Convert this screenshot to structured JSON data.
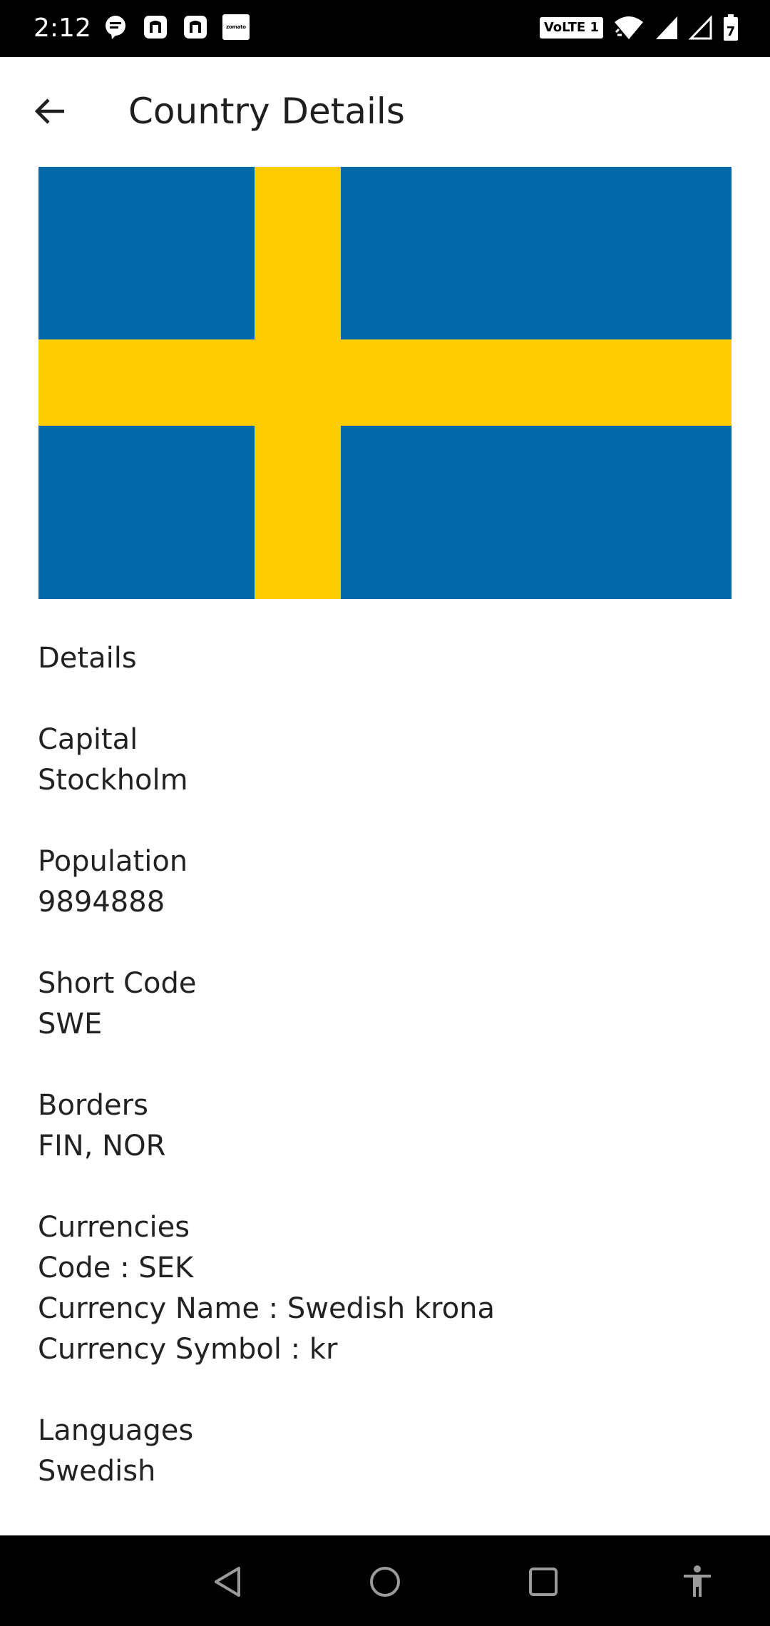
{
  "status_bar": {
    "time": "2:12",
    "notification_icons": [
      "message-icon",
      "app-icon",
      "app-icon",
      "zomato-icon"
    ],
    "zomato_label": "zomato",
    "volte_label": "VoLTE 1",
    "system_icons": [
      "wifi-icon",
      "signal-icon",
      "signal-empty-icon",
      "battery-icon"
    ],
    "battery_level": "7"
  },
  "app_bar": {
    "title": "Country Details",
    "back_icon": "arrow-left-icon"
  },
  "flag": {
    "country": "Sweden",
    "colors": {
      "blue": "#0469a8",
      "yellow": "#fecc02"
    }
  },
  "details": {
    "heading": "Details",
    "capital": {
      "label": "Capital",
      "value": "Stockholm"
    },
    "population": {
      "label": "Population",
      "value": "9894888"
    },
    "short_code": {
      "label": "Short Code",
      "value": "SWE"
    },
    "borders": {
      "label": "Borders",
      "value": "FIN, NOR"
    },
    "currencies": {
      "label": "Currencies",
      "code": "Code : SEK",
      "name": "Currency Name : Swedish krona",
      "symbol": "Currency Symbol : kr"
    },
    "languages": {
      "label": "Languages",
      "value": "Swedish"
    }
  },
  "nav_bar": {
    "buttons": [
      "back-triangle-icon",
      "home-circle-icon",
      "recents-square-icon",
      "accessibility-icon"
    ]
  }
}
